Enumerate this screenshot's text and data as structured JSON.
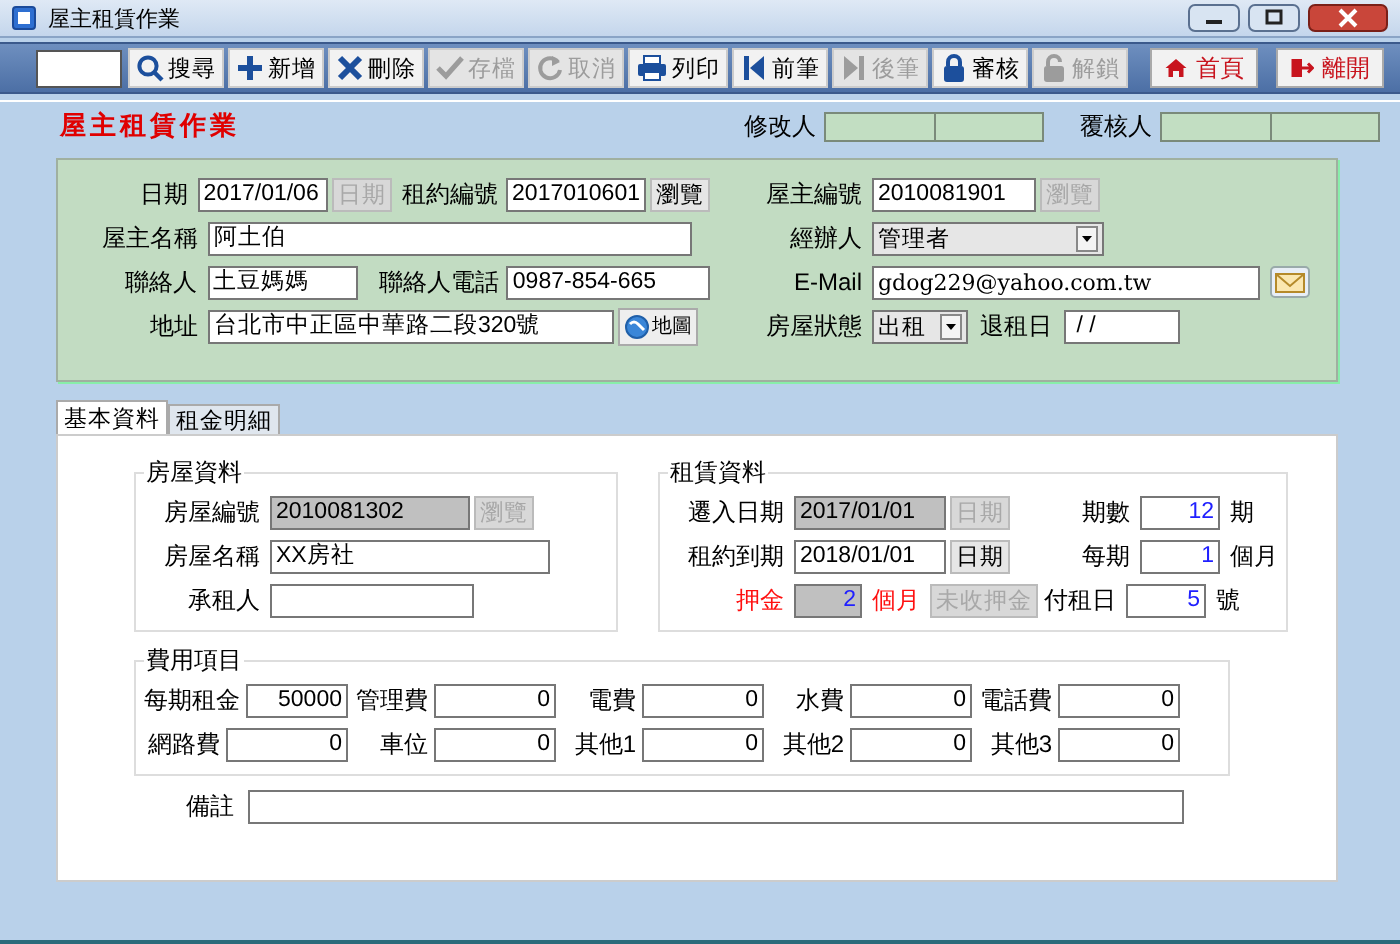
{
  "window": {
    "title": "屋主租賃作業"
  },
  "toolbar": [
    {
      "label": "搜尋",
      "kind": "search",
      "disabled": false
    },
    {
      "label": "新增",
      "kind": "plus",
      "disabled": false
    },
    {
      "label": "刪除",
      "kind": "cross",
      "disabled": false
    },
    {
      "label": "存檔",
      "kind": "check",
      "disabled": true
    },
    {
      "label": "取消",
      "kind": "undo",
      "disabled": true
    },
    {
      "label": "列印",
      "kind": "printer",
      "disabled": false
    },
    {
      "label": "前筆",
      "kind": "prev",
      "disabled": false
    },
    {
      "label": "後筆",
      "kind": "next",
      "disabled": true
    },
    {
      "label": "審核",
      "kind": "lock",
      "disabled": false
    },
    {
      "label": "解鎖",
      "kind": "unlock",
      "disabled": true
    }
  ],
  "nav": [
    {
      "label": "首頁",
      "kind": "home"
    },
    {
      "label": "離開",
      "kind": "exit"
    }
  ],
  "header": {
    "title": "屋主租賃作業",
    "modifier_label": "修改人",
    "reviewer_label": "覆核人"
  },
  "lease": {
    "date": {
      "label": "日期",
      "value": "2017/01/06"
    },
    "date_button": {
      "label": "日期",
      "disabled": true
    },
    "lease_no": {
      "label": "租約編號",
      "value": "2017010601"
    },
    "lease_browse": {
      "label": "瀏覽",
      "disabled": false
    },
    "owner_no": {
      "label": "屋主編號",
      "value": "2010081901"
    },
    "owner_browse": {
      "label": "瀏覽",
      "disabled": true
    },
    "owner_name": {
      "label": "屋主名稱",
      "value": "阿土伯"
    },
    "agent": {
      "label": "經辦人",
      "value": "管理者"
    },
    "contact": {
      "label": "聯絡人",
      "value": "土豆媽媽"
    },
    "phone": {
      "label": "聯絡人電話",
      "value": "0987-854-665"
    },
    "email": {
      "label": "E-Mail",
      "value": "gdog229@yahoo.com.tw"
    },
    "address": {
      "label": "地址",
      "value": "台北市中正區中華路二段320號"
    },
    "map_button": {
      "label": "地圖"
    },
    "status": {
      "label": "房屋狀態",
      "value": "出租"
    },
    "end_date": {
      "label": "退租日",
      "value": " / /"
    }
  },
  "tabs": [
    {
      "label": "基本資料",
      "selected": true
    },
    {
      "label": "租金明細",
      "selected": false
    }
  ],
  "house": {
    "title": "房屋資料",
    "no": {
      "label": "房屋編號",
      "value": "2010081302",
      "readonly": true
    },
    "browse": {
      "label": "瀏覽",
      "disabled": true
    },
    "name": {
      "label": "房屋名稱",
      "value": "XX房社",
      "readonly": false
    },
    "tenant": {
      "label": "承租人",
      "readonly": false
    }
  },
  "rent": {
    "title": "租賃資料",
    "move_in": {
      "label": "遷入日期",
      "value": "2017/01/01",
      "readonly": true
    },
    "move_in_button": {
      "label": "日期",
      "disabled": true
    },
    "expiry": {
      "label": "租約到期",
      "value": "2018/01/01",
      "readonly": false
    },
    "expiry_button": {
      "label": "日期",
      "disabled": false
    },
    "deposit": {
      "label": "押金",
      "value": "2",
      "unit": "個月",
      "readonly": true
    },
    "deposit_button": {
      "label": "未收押金",
      "disabled": true
    },
    "periods": {
      "label": "期數",
      "value": "12",
      "unit": "期"
    },
    "each": {
      "label": "每期",
      "value": "1",
      "unit": "個月"
    },
    "pay_day": {
      "label": "付租日",
      "value": "5",
      "unit": "號"
    }
  },
  "fees": {
    "title": "費用項目",
    "items": [
      {
        "label": "每期租金",
        "value": "50000"
      },
      {
        "label": "管理費",
        "value": "0"
      },
      {
        "label": "電費",
        "value": "0"
      },
      {
        "label": "水費",
        "value": "0"
      },
      {
        "label": "電話費",
        "value": "0"
      },
      {
        "label": "網路費",
        "value": "0"
      },
      {
        "label": "車位",
        "value": "0"
      },
      {
        "label": "其他1",
        "value": "0"
      },
      {
        "label": "其他2",
        "value": "0"
      },
      {
        "label": "其他3",
        "value": "0"
      }
    ]
  },
  "note": {
    "label": "備註"
  }
}
